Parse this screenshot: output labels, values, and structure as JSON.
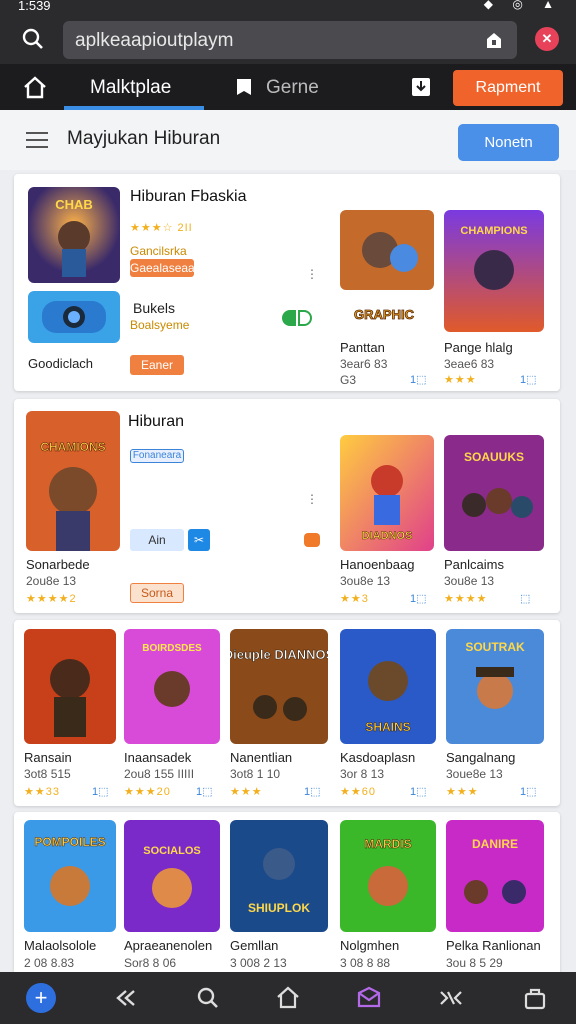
{
  "status": {
    "time": "1:539",
    "icons": "◆ ◎ ▲"
  },
  "browser": {
    "url": "aplkeaapioutplaym"
  },
  "tabs": {
    "market": "Malktplae",
    "game": "Gerne",
    "report": "Rapment"
  },
  "header": {
    "title": "Mayjukan Hiburan",
    "button": "Nonetn"
  },
  "card1": {
    "title": "Hiburan Fbaskia",
    "rating": "★★★☆ 2II",
    "sub1": "Gancilsrka",
    "btn1": "Gaealaseaa",
    "row2_title": "Bukels",
    "row2_sub": "Boalsyeme",
    "row3_label": "Goodiclach",
    "row3_btn": "Eaner",
    "apps": [
      {
        "name": "Panttan",
        "sub": "3ear6 83",
        "meta": "G3",
        "badge": "1⬚"
      },
      {
        "name": "Pange hlalg",
        "sub": "3eae6 83",
        "meta": "★★★",
        "badge": "1⬚"
      }
    ]
  },
  "card2": {
    "title": "Hiburan",
    "chip": "Fonaneara",
    "left_title": "Sonarbede",
    "left_sub": "2ou8e 13",
    "left_stars": "★★★★2",
    "left_btn": "Sorna",
    "mini_chip": "Ain",
    "apps": [
      {
        "name": "Hanoenbaag",
        "sub": "3ou8e 13",
        "meta": "★★3",
        "badge": "1⬚"
      },
      {
        "name": "Panlcaims",
        "sub": "3ou8e 13",
        "meta": "★★★★",
        "badge": "⬚"
      }
    ]
  },
  "card3": {
    "apps": [
      {
        "name": "Ransain",
        "sub": "3ot8 515",
        "meta": "★★33",
        "badge": "1⬚"
      },
      {
        "name": "Inaansadek",
        "sub": "2ou8 155 IIIII",
        "meta": "★★★20",
        "badge": "1⬚"
      },
      {
        "name": "Nanentlian",
        "sub": "3ot8 1 10",
        "meta": "★★★",
        "badge": "1⬚"
      },
      {
        "name": "Kasdoaplasn",
        "sub": "3or 8 13",
        "meta": "★★60",
        "badge": "1⬚"
      },
      {
        "name": "Sangalnang",
        "sub": "3oue8e 13",
        "meta": "★★★",
        "badge": "1⬚"
      }
    ]
  },
  "card4": {
    "apps": [
      {
        "name": "Malaolsolole",
        "sub": "2 08 8.83"
      },
      {
        "name": "Apraeanenolen",
        "sub": "Sor8 8 06"
      },
      {
        "name": "Gemllan",
        "sub": "3 008 2 13"
      },
      {
        "name": "Nolgmhen",
        "sub": "3 08 8 88"
      },
      {
        "name": "Pelka Ranlionan",
        "sub": "3ou 8 5 29"
      }
    ]
  },
  "thumb_titles": {
    "c1a": "CHAB",
    "c1b": "GRAPHIC",
    "c1c": "CHAMPIONS",
    "c2a": "CHAMIONS",
    "c2b": "DIADNOS",
    "c2c": "SOAUUKS",
    "c3a": "BOIRDSDES",
    "c3b": "Dieuple DIANNOS",
    "c3c": "SHAINS",
    "c3d": "SOUTRAK",
    "c4a": "POMPOILES",
    "c4b": "SOCIALOS",
    "c4c": "SHIUPLOK",
    "c4d": "MARDIS",
    "c4e": "DANIRE"
  },
  "colors": {
    "accent": "#3b8ee6",
    "orange": "#f0642c",
    "star": "#f2b01e"
  }
}
